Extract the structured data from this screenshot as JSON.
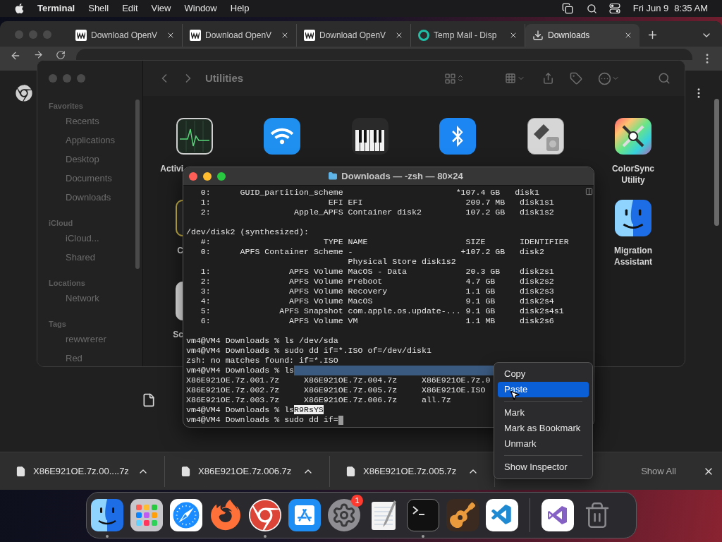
{
  "menu_bar": {
    "app": "Terminal",
    "menus": [
      "Shell",
      "Edit",
      "View",
      "Window",
      "Help"
    ],
    "date": "Fri Jun 9",
    "time": "8:35 AM"
  },
  "browser": {
    "tabs": [
      {
        "title": "Download OpenV",
        "kind": "page",
        "selected": false
      },
      {
        "title": "Download OpenV",
        "kind": "page",
        "selected": false
      },
      {
        "title": "Download OpenV",
        "kind": "page",
        "selected": false
      },
      {
        "title": "Temp Mail - Disp",
        "kind": "mail",
        "selected": false
      },
      {
        "title": "Downloads",
        "kind": "downloads",
        "selected": true
      }
    ],
    "shelf": {
      "items": [
        {
          "name": "X86E921OE.7z.00....7z"
        },
        {
          "name": "X86E921OE.7z.006.7z"
        },
        {
          "name": "X86E921OE.7z.005.7z"
        }
      ],
      "show_all": "Show All"
    }
  },
  "finder": {
    "title": "Utilities",
    "sidebar": [
      {
        "title": "Favorites",
        "items": [
          "Recents",
          "Applications",
          "Desktop",
          "Documents",
          "Downloads"
        ]
      },
      {
        "title": "iCloud",
        "items": [
          "iCloud...",
          "Shared"
        ]
      },
      {
        "title": "Locations",
        "items": [
          "Network"
        ]
      },
      {
        "title": "Tags",
        "items": [
          "rewwrerer",
          "Red"
        ]
      }
    ],
    "rows": [
      {
        "items": [
          {
            "kind": "cut",
            "label": "Activi"
          },
          {
            "kind": "icon"
          },
          {
            "kind": "icon"
          },
          {
            "kind": "icon"
          },
          {
            "kind": "icon"
          },
          {
            "kind": "full",
            "label": "ColorSync Utility"
          }
        ]
      },
      {
        "items": [
          {
            "kind": "partial",
            "label": "C"
          },
          {
            "kind": "full",
            "label": "Migration Assistant"
          }
        ]
      },
      {
        "items": [
          {
            "kind": "partial",
            "label": "Sc"
          }
        ]
      }
    ]
  },
  "terminal": {
    "title": "Downloads — -zsh — 80×24",
    "lines": [
      {
        "kind": "output",
        "text": "   0:      GUID_partition_scheme                       *107.4 GB   disk1"
      },
      {
        "kind": "output",
        "text": "   1:                        EFI EFI                     209.7 MB   disk1s1"
      },
      {
        "kind": "output",
        "text": "   2:                 Apple_APFS Container disk2         107.2 GB   disk1s2"
      },
      {
        "kind": "blank"
      },
      {
        "kind": "output",
        "text": "/dev/disk2 (synthesized):"
      },
      {
        "kind": "output",
        "text": "   #:                       TYPE NAME                    SIZE       IDENTIFIER"
      },
      {
        "kind": "output",
        "text": "   0:      APFS Container Scheme -                      +107.2 GB   disk2"
      },
      {
        "kind": "output",
        "text": "                                 Physical Store disk1s2"
      },
      {
        "kind": "output",
        "text": "   1:                APFS Volume MacOS - Data            20.3 GB    disk2s1"
      },
      {
        "kind": "output",
        "text": "   2:                APFS Volume Preboot                 4.7 GB     disk2s2"
      },
      {
        "kind": "output",
        "text": "   3:                APFS Volume Recovery                1.1 GB     disk2s3"
      },
      {
        "kind": "output",
        "text": "   4:                APFS Volume MacOS                   9.1 GB     disk2s4"
      },
      {
        "kind": "output",
        "text": "   5:              APFS Snapshot com.apple.os.update-... 9.1 GB     disk2s4s1"
      },
      {
        "kind": "output",
        "text": "   6:                APFS Volume VM                      1.1 MB     disk2s6"
      },
      {
        "kind": "blank"
      },
      {
        "kind": "output",
        "text": "vm4@VM4 Downloads % ls /dev/sda"
      },
      {
        "kind": "output",
        "text": "vm4@VM4 Downloads % sudo dd if=*.ISO of=/dev/disk1"
      },
      {
        "kind": "output",
        "text": "zsh: no matches found: if=*.ISO"
      },
      {
        "kind": "selection",
        "text": "vm4@VM4 Downloads % ls"
      },
      {
        "kind": "output",
        "text": "X86E921OE.7z.001.7z     X86E921OE.7z.004.7z     X86E921OE.7z.0"
      },
      {
        "kind": "output",
        "text": "X86E921OE.7z.002.7z     X86E921OE.7z.005.7z     X86E921OE.ISO"
      },
      {
        "kind": "output",
        "text": "X86E921OE.7z.003.7z     X86E921OE.7z.006.7z     all.7z"
      },
      {
        "kind": "paste",
        "text": "vm4@VM4 Downloads % ls",
        "inverted": "R9RsYS"
      },
      {
        "kind": "input",
        "text": "vm4@VM4 Downloads % sudo dd if="
      }
    ]
  },
  "context_menu": {
    "items": [
      {
        "kind": "item",
        "label": "Copy",
        "selected": false
      },
      {
        "kind": "item",
        "label": "Paste",
        "selected": true
      },
      {
        "kind": "separator"
      },
      {
        "kind": "item",
        "label": "Mark",
        "selected": false
      },
      {
        "kind": "item",
        "label": "Mark as Bookmark",
        "selected": false
      },
      {
        "kind": "item",
        "label": "Unmark",
        "selected": false
      },
      {
        "kind": "separator"
      },
      {
        "kind": "item",
        "label": "Show Inspector",
        "selected": false
      }
    ]
  },
  "dock": {
    "apps": [
      {
        "running": true
      },
      {
        "running": false
      },
      {
        "running": false
      },
      {
        "running": false
      },
      {
        "running": true
      },
      {
        "running": false
      },
      {
        "running": false,
        "badge": "1"
      },
      {
        "running": false
      },
      {
        "running": true
      },
      {
        "running": false
      },
      {
        "running": false
      }
    ],
    "others": [
      {
        "running": false
      },
      {
        "running": false
      }
    ]
  }
}
